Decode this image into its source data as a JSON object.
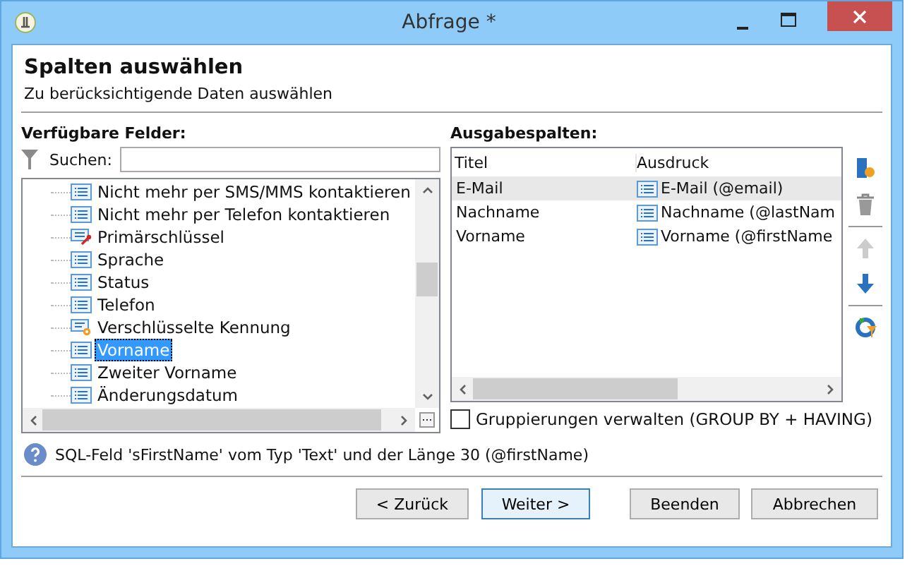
{
  "window": {
    "title": "Abfrage *"
  },
  "header": {
    "title": "Spalten auswählen",
    "subtitle": "Zu berücksichtigende Daten auswählen"
  },
  "available": {
    "label": "Verfügbare Felder:",
    "search_label": "Suchen:",
    "items": [
      {
        "label": "Nicht mehr per SMS/MMS kontaktieren",
        "kind": "field",
        "selected": false
      },
      {
        "label": "Nicht mehr per Telefon kontaktieren",
        "kind": "field",
        "selected": false
      },
      {
        "label": "Primärschlüssel",
        "kind": "key",
        "selected": false
      },
      {
        "label": "Sprache",
        "kind": "field",
        "selected": false
      },
      {
        "label": "Status",
        "kind": "field",
        "selected": false
      },
      {
        "label": "Telefon",
        "kind": "field",
        "selected": false
      },
      {
        "label": "Verschlüsselte Kennung",
        "kind": "computed",
        "selected": false
      },
      {
        "label": "Vorname",
        "kind": "field",
        "selected": true
      },
      {
        "label": "Zweiter Vorname",
        "kind": "field",
        "selected": false
      },
      {
        "label": "Änderungsdatum",
        "kind": "field",
        "selected": false
      }
    ]
  },
  "output": {
    "label": "Ausgabespalten:",
    "columns": [
      "Titel",
      "Ausdruck"
    ],
    "rows": [
      {
        "title": "E-Mail",
        "expression": "E-Mail (@email)",
        "selected": true
      },
      {
        "title": "Nachname",
        "expression": "Nachname (@lastNam",
        "selected": false
      },
      {
        "title": "Vorname",
        "expression": "Vorname (@firstName",
        "selected": false
      }
    ],
    "grouping": {
      "label": "Gruppierungen verwalten (GROUP BY + HAVING)",
      "checked": false
    }
  },
  "info": "SQL-Feld 'sFirstName' vom Typ 'Text' und der Länge 30 (@firstName)",
  "buttons": [
    {
      "label": "< Zurück",
      "focused": false
    },
    {
      "label": "Weiter >",
      "focused": true
    },
    {
      "label": "Beenden",
      "focused": false
    },
    {
      "label": "Abbrechen",
      "focused": false
    }
  ]
}
